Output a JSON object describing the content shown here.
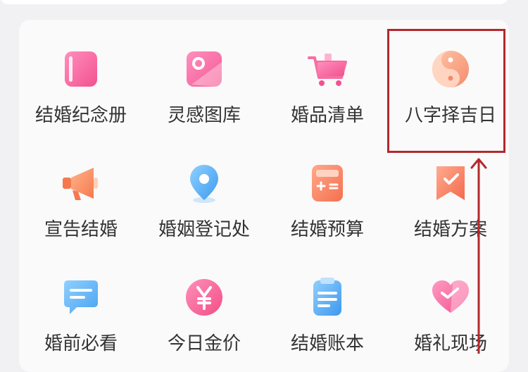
{
  "colors": {
    "accent_pink": "#f66ea1",
    "annotation_red": "#b4282d",
    "text": "#333333"
  },
  "grid": {
    "items": [
      {
        "label": "结婚纪念册",
        "icon": "album-icon"
      },
      {
        "label": "灵感图库",
        "icon": "gallery-icon"
      },
      {
        "label": "婚品清单",
        "icon": "cart-icon"
      },
      {
        "label": "八字择吉日",
        "icon": "yin-yang-icon"
      },
      {
        "label": "宣告结婚",
        "icon": "megaphone-icon"
      },
      {
        "label": "婚姻登记处",
        "icon": "location-pin-icon"
      },
      {
        "label": "结婚预算",
        "icon": "calculator-icon"
      },
      {
        "label": "结婚方案",
        "icon": "bookmark-check-icon"
      },
      {
        "label": "婚前必看",
        "icon": "message-icon"
      },
      {
        "label": "今日金价",
        "icon": "yuan-coin-icon"
      },
      {
        "label": "结婚账本",
        "icon": "notebook-icon"
      },
      {
        "label": "婚礼现场",
        "icon": "heart-icon"
      }
    ]
  }
}
